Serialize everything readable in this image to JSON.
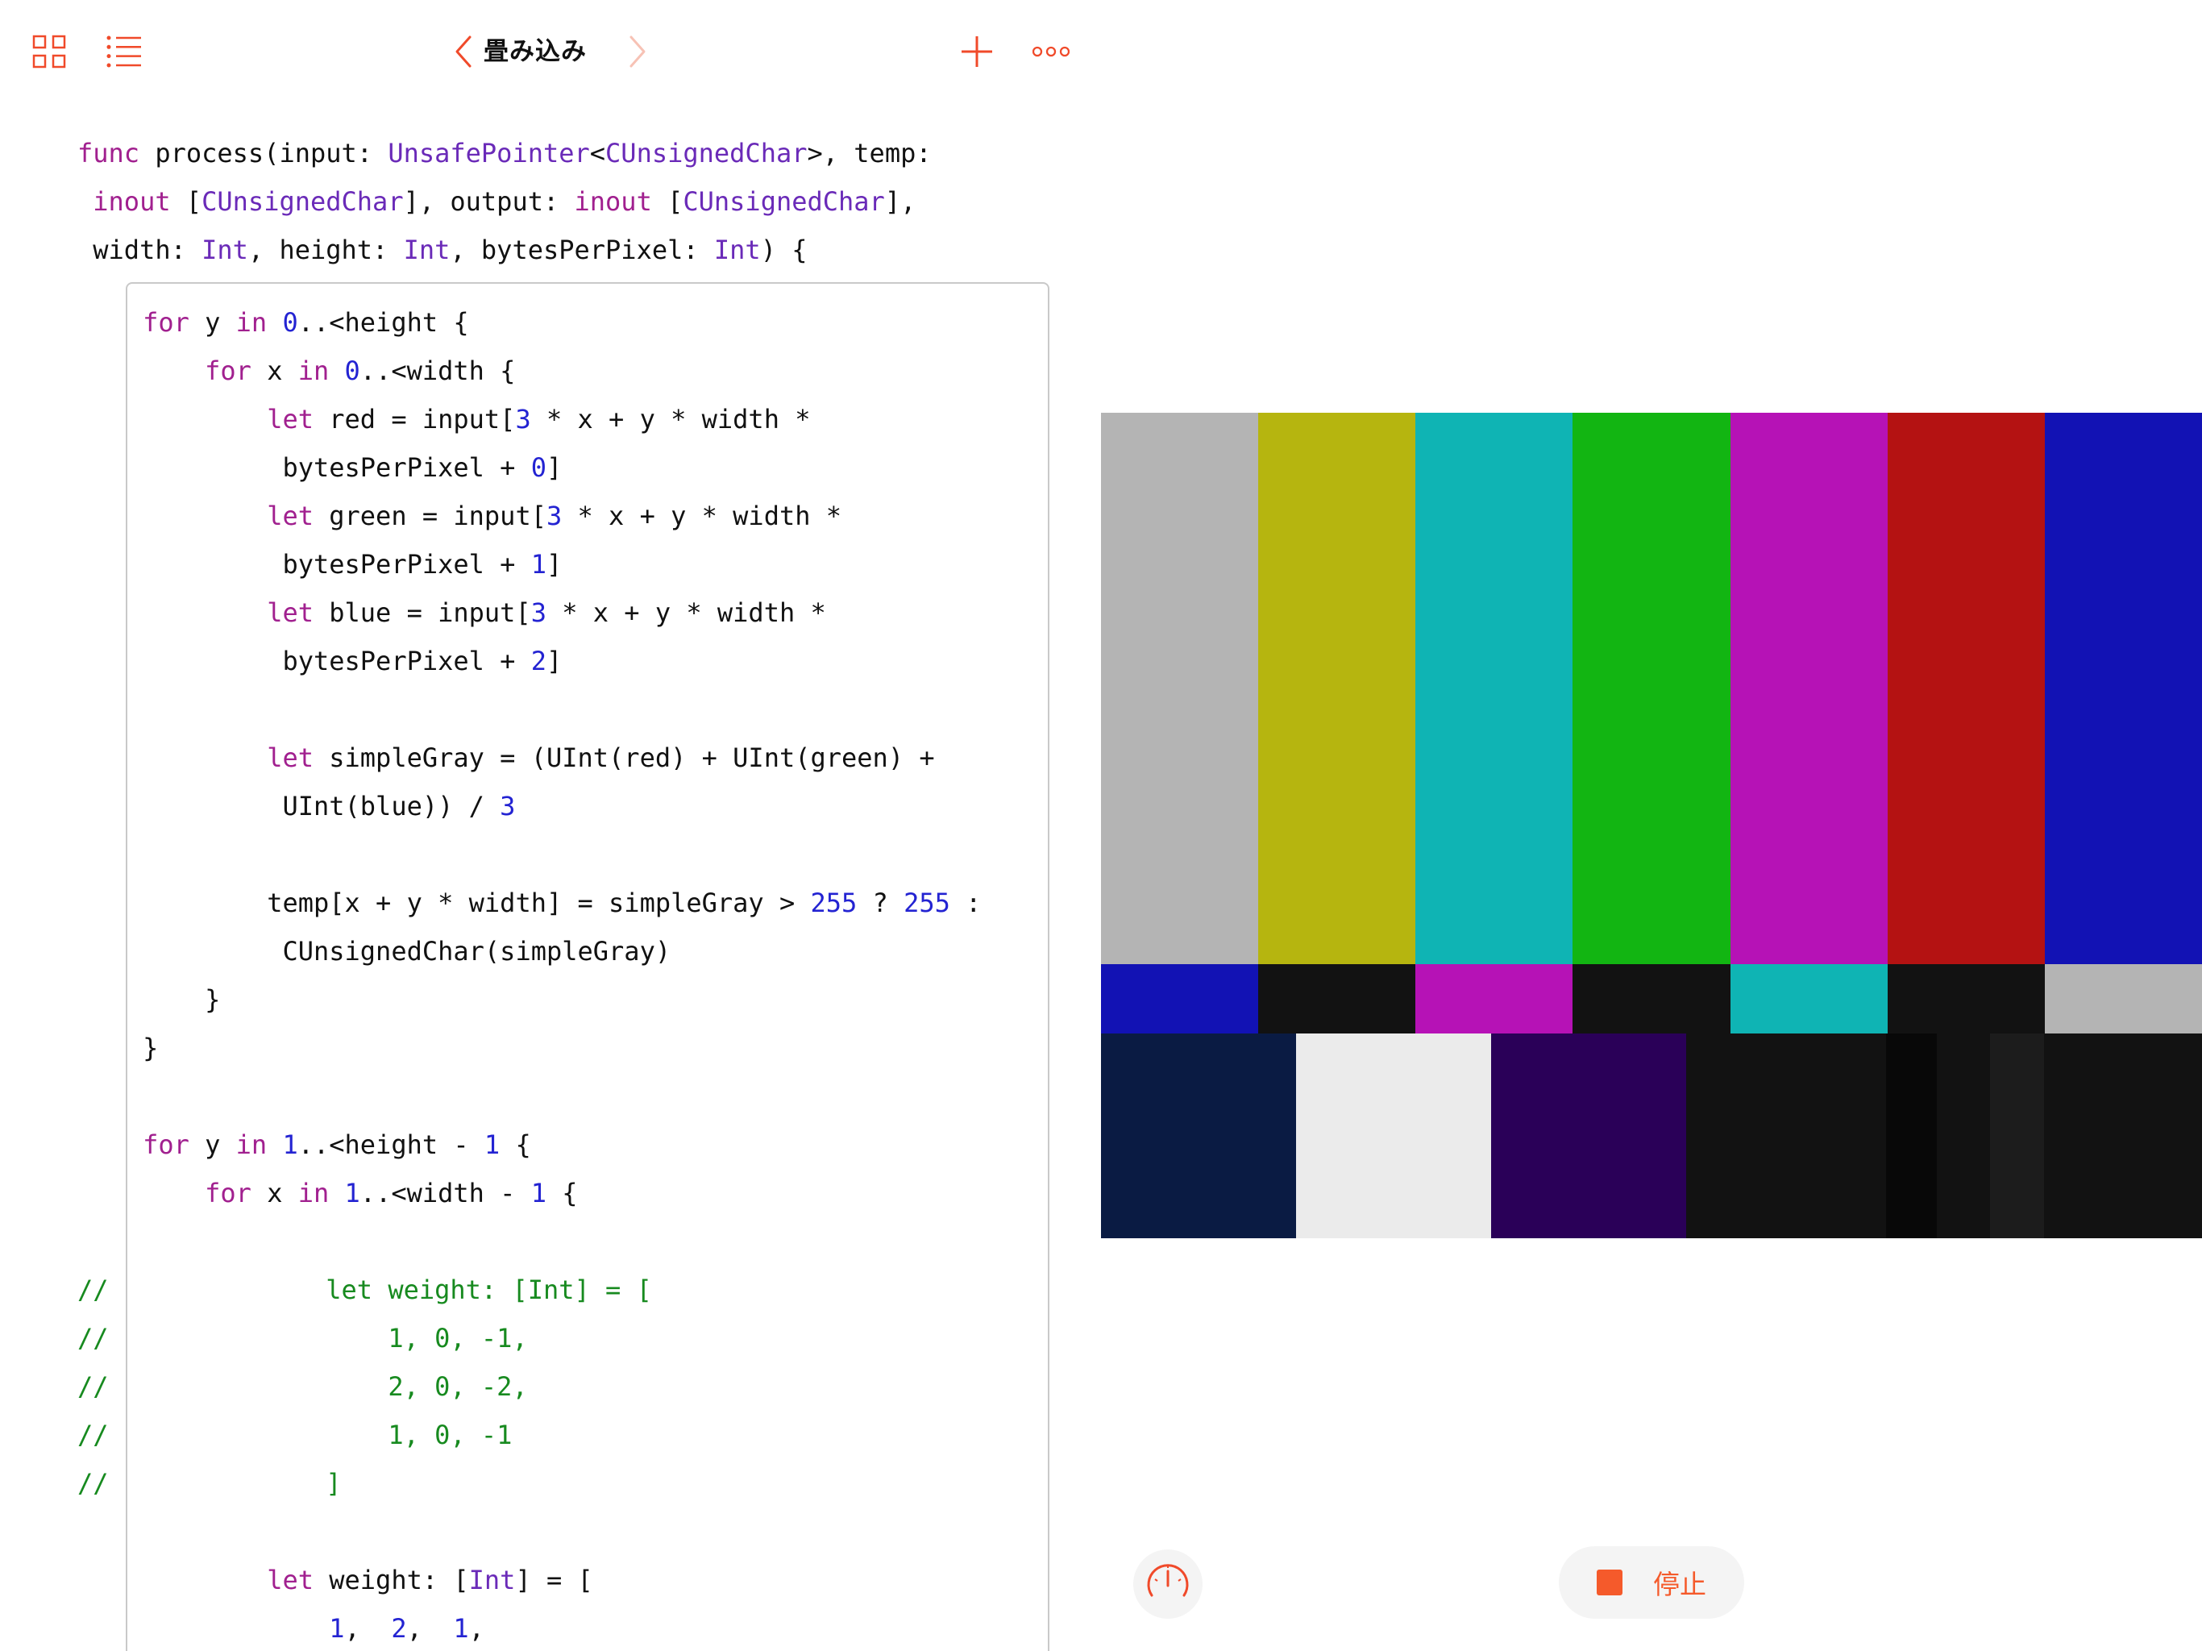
{
  "toolbar": {
    "title": "畳み込み",
    "icons": [
      "grid-icon",
      "list-icon",
      "chevron-left-icon",
      "chevron-right-icon",
      "plus-icon",
      "more-icon"
    ],
    "accent_color": "#f04a2a"
  },
  "code": {
    "lines": [
      [
        [
          "kw",
          "func"
        ],
        [
          "",
          " process(input: "
        ],
        [
          "ty",
          "UnsafePointer"
        ],
        [
          "",
          "<"
        ],
        [
          "ty",
          "CUnsignedChar"
        ],
        [
          "",
          ">, temp:"
        ]
      ],
      [
        [
          "",
          " "
        ],
        [
          "kw",
          "inout"
        ],
        [
          "",
          " ["
        ],
        [
          "ty",
          "CUnsignedChar"
        ],
        [
          "",
          "], output: "
        ],
        [
          "kw",
          "inout"
        ],
        [
          "",
          " ["
        ],
        [
          "ty",
          "CUnsignedChar"
        ],
        [
          "",
          "],"
        ]
      ],
      [
        [
          "",
          " width: "
        ],
        [
          "ty",
          "Int"
        ],
        [
          "",
          ", height: "
        ],
        [
          "ty",
          "Int"
        ],
        [
          "",
          ", bytesPerPixel: "
        ],
        [
          "ty",
          "Int"
        ],
        [
          "",
          ") {"
        ]
      ],
      [
        [
          "",
          "    "
        ],
        [
          "kw",
          "for"
        ],
        [
          "",
          " y "
        ],
        [
          "kw",
          "in"
        ],
        [
          "",
          " "
        ],
        [
          "num",
          "0"
        ],
        [
          "",
          "..<height {"
        ]
      ],
      [
        [
          "",
          "        "
        ],
        [
          "kw",
          "for"
        ],
        [
          "",
          " x "
        ],
        [
          "kw",
          "in"
        ],
        [
          "",
          " "
        ],
        [
          "num",
          "0"
        ],
        [
          "",
          "..<width {"
        ]
      ],
      [
        [
          "",
          "            "
        ],
        [
          "kw",
          "let"
        ],
        [
          "",
          " red = input["
        ],
        [
          "num",
          "3"
        ],
        [
          "",
          " * x + y * width *"
        ]
      ],
      [
        [
          "",
          "             bytesPerPixel + "
        ],
        [
          "num",
          "0"
        ],
        [
          "",
          "]"
        ]
      ],
      [
        [
          "",
          "            "
        ],
        [
          "kw",
          "let"
        ],
        [
          "",
          " green = input["
        ],
        [
          "num",
          "3"
        ],
        [
          "",
          " * x + y * width *"
        ]
      ],
      [
        [
          "",
          "             bytesPerPixel + "
        ],
        [
          "num",
          "1"
        ],
        [
          "",
          "]"
        ]
      ],
      [
        [
          "",
          "            "
        ],
        [
          "kw",
          "let"
        ],
        [
          "",
          " blue = input["
        ],
        [
          "num",
          "3"
        ],
        [
          "",
          " * x + y * width *"
        ]
      ],
      [
        [
          "",
          "             bytesPerPixel + "
        ],
        [
          "num",
          "2"
        ],
        [
          "",
          "]"
        ]
      ],
      [
        [
          "",
          ""
        ]
      ],
      [
        [
          "",
          "            "
        ],
        [
          "kw",
          "let"
        ],
        [
          "",
          " simpleGray = (UInt(red) + UInt(green) +"
        ]
      ],
      [
        [
          "",
          "             UInt(blue)) / "
        ],
        [
          "num",
          "3"
        ]
      ],
      [
        [
          "",
          ""
        ]
      ],
      [
        [
          "",
          "            temp[x + y * width] = simpleGray > "
        ],
        [
          "num",
          "255"
        ],
        [
          "",
          " ? "
        ],
        [
          "num",
          "255"
        ],
        [
          "",
          " :"
        ]
      ],
      [
        [
          "",
          "             CUnsignedChar(simpleGray)"
        ]
      ],
      [
        [
          "",
          "        }"
        ]
      ],
      [
        [
          "",
          "    }"
        ]
      ],
      [
        [
          "",
          ""
        ]
      ],
      [
        [
          "",
          "    "
        ],
        [
          "kw",
          "for"
        ],
        [
          "",
          " y "
        ],
        [
          "kw",
          "in"
        ],
        [
          "",
          " "
        ],
        [
          "num",
          "1"
        ],
        [
          "",
          "..<height - "
        ],
        [
          "num",
          "1"
        ],
        [
          "",
          " {"
        ]
      ],
      [
        [
          "",
          "        "
        ],
        [
          "kw",
          "for"
        ],
        [
          "",
          " x "
        ],
        [
          "kw",
          "in"
        ],
        [
          "",
          " "
        ],
        [
          "num",
          "1"
        ],
        [
          "",
          "..<width - "
        ],
        [
          "num",
          "1"
        ],
        [
          "",
          " {"
        ]
      ],
      [
        [
          "",
          ""
        ]
      ],
      [
        [
          "cm",
          "//              let weight: [Int] = ["
        ]
      ],
      [
        [
          "cm",
          "//                  1, 0, -1,"
        ]
      ],
      [
        [
          "cm",
          "//                  2, 0, -2,"
        ]
      ],
      [
        [
          "cm",
          "//                  1, 0, -1"
        ]
      ],
      [
        [
          "cm",
          "//              ]"
        ]
      ],
      [
        [
          "",
          ""
        ]
      ],
      [
        [
          "",
          "            "
        ],
        [
          "kw",
          "let"
        ],
        [
          "",
          " weight: ["
        ],
        [
          "ty",
          "Int"
        ],
        [
          "",
          "] = ["
        ]
      ],
      [
        [
          "",
          "                "
        ],
        [
          "num",
          "1"
        ],
        [
          "",
          ",  "
        ],
        [
          "num",
          "2"
        ],
        [
          "",
          ",  "
        ],
        [
          "num",
          "1"
        ],
        [
          "",
          ","
        ]
      ]
    ]
  },
  "liveview": {
    "top_bars": [
      "#b4b4b4",
      "#b6b50f",
      "#0fb4b4",
      "#12b512",
      "#b612b6",
      "#b41212",
      "#1212b4"
    ],
    "middle_bars": [
      "#1212b4",
      "#121212",
      "#b612b6",
      "#121212",
      "#0fb4b4",
      "#121212",
      "#b4b4b4"
    ],
    "bottom_bars": [
      "#0a1b43",
      "#ebebeb",
      "#2a0058",
      "#121212",
      "#121212",
      "#080808",
      "#121212",
      "#1c1c1c",
      "#121212"
    ]
  },
  "controls": {
    "meter_icon": "speedometer-icon",
    "stop_label": "停止"
  }
}
